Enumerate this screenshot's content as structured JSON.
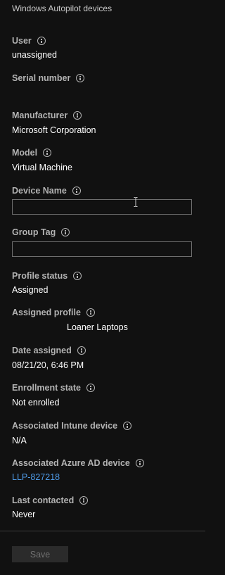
{
  "header": {
    "breadcrumb": "Windows Autopilot devices"
  },
  "fields": {
    "user": {
      "label": "User",
      "value": "unassigned"
    },
    "serial_number": {
      "label": "Serial number",
      "value": ""
    },
    "manufacturer": {
      "label": "Manufacturer",
      "value": "Microsoft Corporation"
    },
    "model": {
      "label": "Model",
      "value": "Virtual Machine"
    },
    "device_name": {
      "label": "Device Name",
      "value": "",
      "placeholder": ""
    },
    "group_tag": {
      "label": "Group Tag",
      "value": "",
      "placeholder": ""
    },
    "profile_status": {
      "label": "Profile status",
      "value": "Assigned"
    },
    "assigned_profile": {
      "label": "Assigned profile",
      "value": "Loaner Laptops"
    },
    "date_assigned": {
      "label": "Date assigned",
      "value": "08/21/20, 6:46 PM"
    },
    "enrollment_state": {
      "label": "Enrollment state",
      "value": "Not enrolled"
    },
    "associated_intune_device": {
      "label": "Associated Intune device",
      "value": "N/A"
    },
    "associated_azure_ad_device": {
      "label": "Associated Azure AD device",
      "value": "LLP-827218"
    },
    "last_contacted": {
      "label": "Last contacted",
      "value": "Never"
    }
  },
  "footer": {
    "save_label": "Save"
  },
  "icons": {
    "info": "info-icon",
    "text_cursor": "text-cursor-icon"
  },
  "colors": {
    "background": "#111111",
    "label": "#b3b3b3",
    "value": "#ffffff",
    "link": "#4f9be8",
    "input_border": "#6e6e6e",
    "button_bg": "#2b2b2b",
    "button_text_disabled": "#707070"
  }
}
